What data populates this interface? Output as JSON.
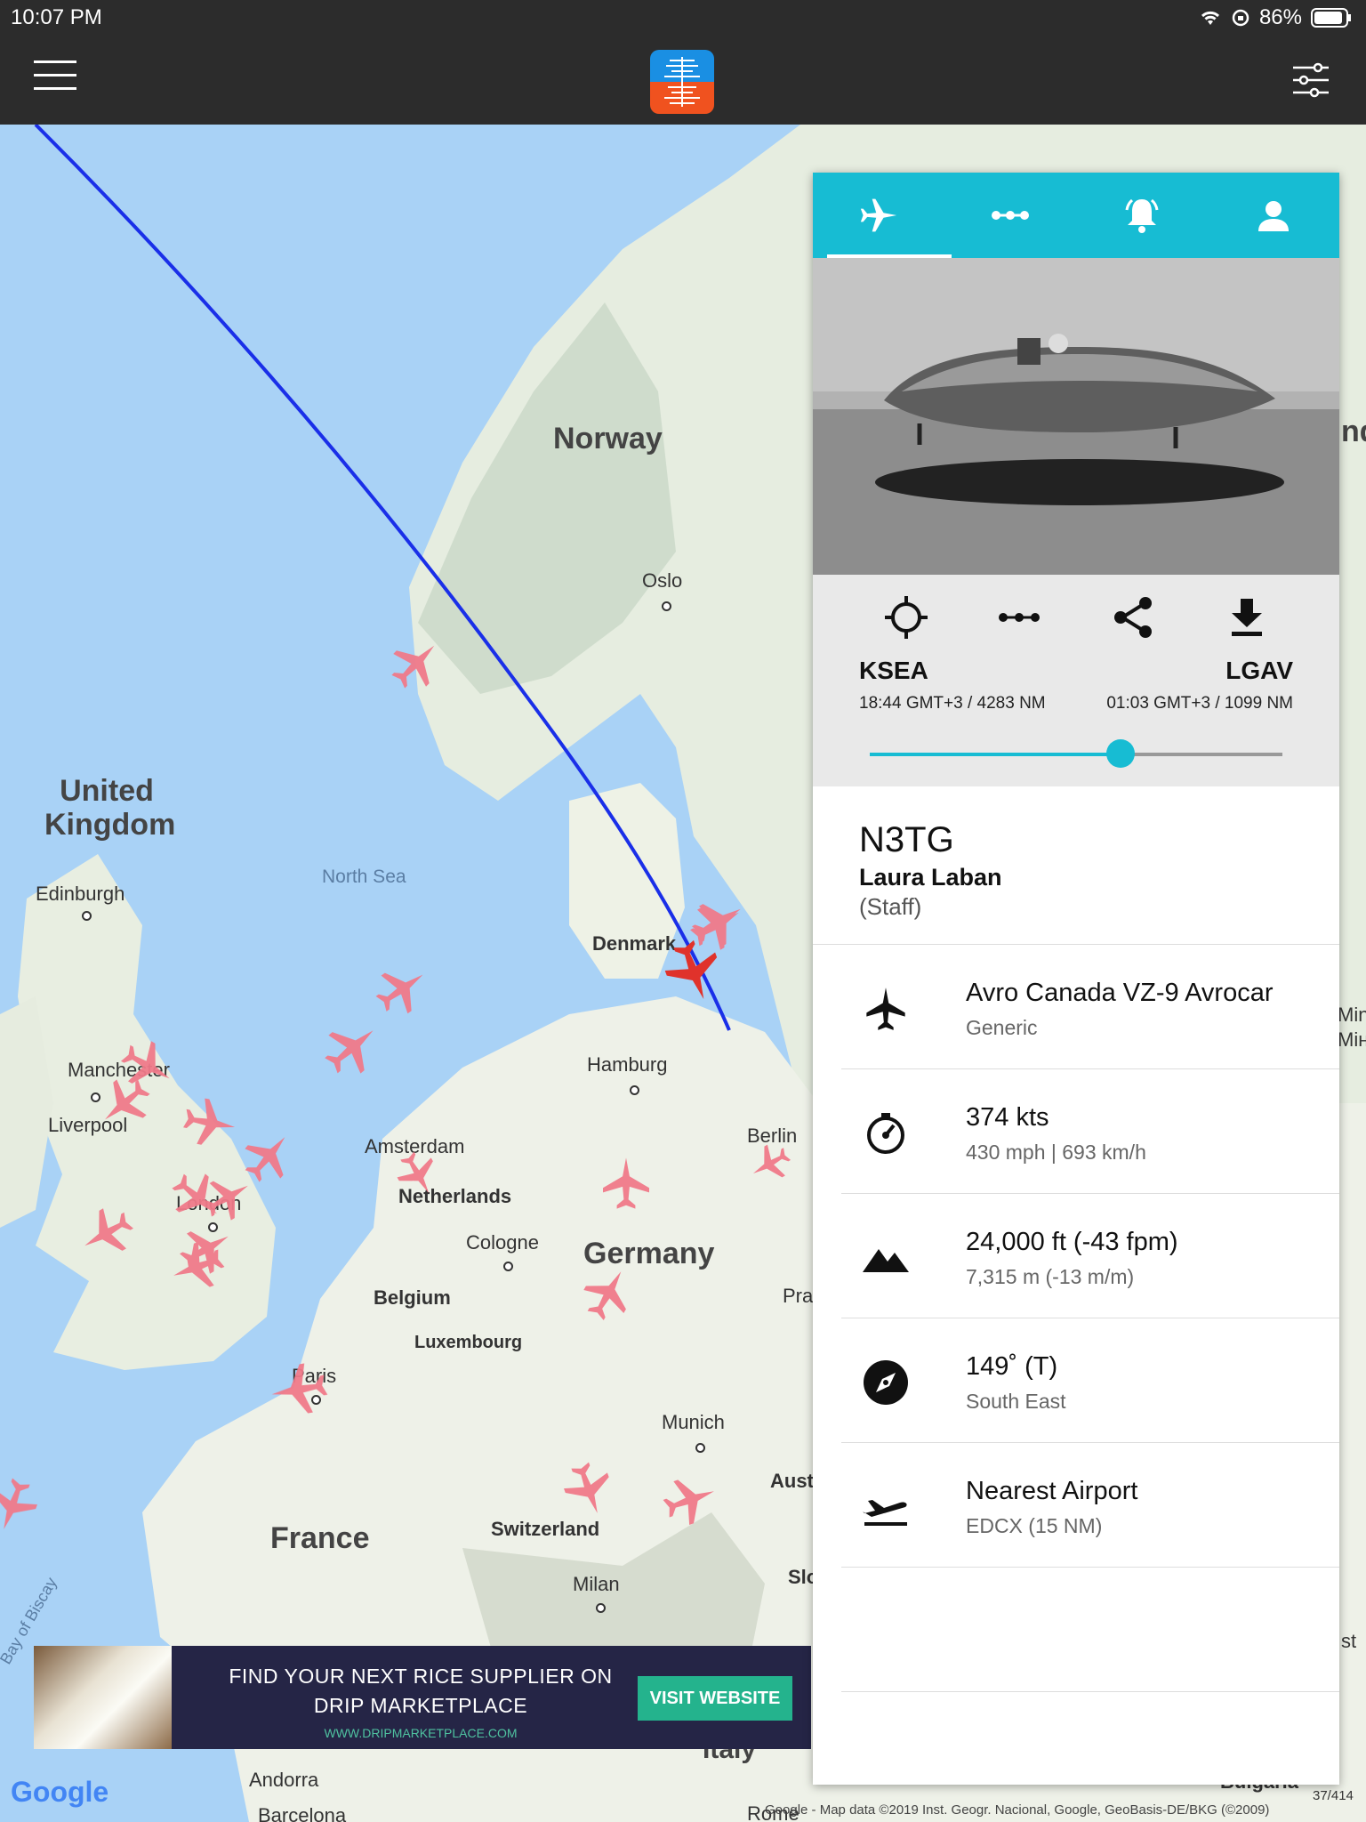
{
  "status_bar": {
    "time": "10:07 PM",
    "battery": "86%"
  },
  "map": {
    "countries": [
      "Norway",
      "United Kingdom",
      "Germany",
      "France",
      "Denmark",
      "Netherlands",
      "Belgium",
      "Luxembourg",
      "Switzerland",
      "Italy"
    ],
    "cities": [
      "Oslo",
      "Edinburgh",
      "Manchester",
      "Liverpool",
      "London",
      "Amsterdam",
      "Cologne",
      "Hamburg",
      "Berlin",
      "Paris",
      "Munich",
      "Milan",
      "Andorra",
      "Barcelona",
      "Rome"
    ],
    "seas": [
      "North Sea",
      "Bay of Biscay"
    ],
    "partial_labels": [
      "Pra",
      "Aust",
      "Slo",
      "Min",
      "Мін",
      "st",
      "Bulgaria",
      "nd"
    ]
  },
  "ad": {
    "headline_1": "FIND YOUR NEXT RICE SUPPLIER ON",
    "headline_2": "DRIP MARKETPLACE",
    "url": "WWW.DRIPMARKETPLACE.COM",
    "cta": "VISIT WEBSITE"
  },
  "google_logo": "Google",
  "attribution": "Map data ©2019 Inst. Geogr. Nacional, Google, GeoBasis-DE/BKG (©2009)",
  "attribution_prefix": "Google",
  "page_counter": "37/414",
  "panel": {
    "tabs": [
      "flight-tab",
      "route-tab",
      "alerts-tab",
      "profile-tab"
    ],
    "route": {
      "origin_code": "KSEA",
      "origin_detail": "18:44 GMT+3 / 4283 NM",
      "destination_code": "LGAV",
      "destination_detail": "01:03 GMT+3 / 1099 NM",
      "progress": 0.607
    },
    "callsign": "N3TG",
    "pilot_name": "Laura Laban",
    "pilot_role": "(Staff)",
    "aircraft": {
      "primary": "Avro Canada VZ-9 Avrocar",
      "secondary": "Generic"
    },
    "speed": {
      "primary": "374 kts",
      "secondary": "430 mph | 693 km/h"
    },
    "altitude": {
      "primary": "24,000 ft (-43 fpm)",
      "secondary": "7,315 m (-13 m/m)"
    },
    "heading": {
      "primary": "149˚ (T)",
      "secondary": "South East"
    },
    "nearest_airport": {
      "primary": "Nearest Airport",
      "secondary": "EDCX (15 NM)"
    }
  },
  "colors": {
    "accent": "#17bcd3",
    "bar": "#2c2c2c",
    "flight_path": "#1a2fe8",
    "plane": "#f07a8a",
    "selected_plane": "#e0322b"
  }
}
